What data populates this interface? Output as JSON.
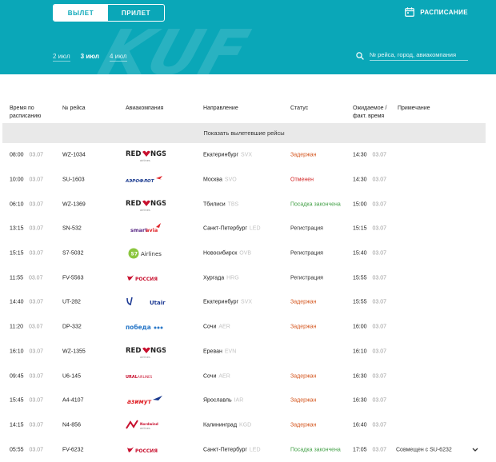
{
  "header": {
    "toggle": {
      "departure": "ВЫЛЕТ",
      "arrival": "ПРИЛЕТ"
    },
    "schedule_label": "РАСПИСАНИЕ",
    "watermark": "KUF",
    "dates": [
      "2 июл",
      "3 июл",
      "4 июл"
    ],
    "active_date": "3 июл",
    "search_placeholder": "№ рейса, город, авиакомпания",
    "accent_color": "#0aa7b8"
  },
  "table": {
    "columns": {
      "scheduled": "Время по расписанию",
      "flight": "№ рейса",
      "airline": "Авиакомпания",
      "destination": "Направление",
      "status": "Статус",
      "expected": "Ожидаемое / факт. время",
      "note": "Примечание"
    },
    "show_departed": "Показать вылетевшие рейсы",
    "rows": [
      {
        "time": "08:00",
        "date": "03.07",
        "flight": "WZ-1034",
        "airline": "redwings",
        "city": "Екатеринбург",
        "code": "SVX",
        "status": "Задержан",
        "status_type": "delayed",
        "exp_time": "14:30",
        "exp_date": "03.07",
        "note": ""
      },
      {
        "time": "10:00",
        "date": "03.07",
        "flight": "SU-1603",
        "airline": "aeroflot",
        "city": "Москва",
        "code": "SVO",
        "status": "Отменен",
        "status_type": "cancelled",
        "exp_time": "14:30",
        "exp_date": "03.07",
        "note": ""
      },
      {
        "time": "06:10",
        "date": "03.07",
        "flight": "WZ-1369",
        "airline": "redwings",
        "city": "Тбилиси",
        "code": "TBS",
        "status": "Посадка закончена",
        "status_type": "boarded",
        "exp_time": "15:00",
        "exp_date": "03.07",
        "note": ""
      },
      {
        "time": "13:15",
        "date": "03.07",
        "flight": "SN-532",
        "airline": "smartavia",
        "city": "Санкт-Петербург",
        "code": "LED",
        "status": "Регистрация",
        "status_type": "checkin",
        "exp_time": "15:15",
        "exp_date": "03.07",
        "note": ""
      },
      {
        "time": "15:15",
        "date": "03.07",
        "flight": "S7-5032",
        "airline": "s7",
        "city": "Новосибирск",
        "code": "OVB",
        "status": "Регистрация",
        "status_type": "checkin",
        "exp_time": "15:40",
        "exp_date": "03.07",
        "note": ""
      },
      {
        "time": "11:55",
        "date": "03.07",
        "flight": "FV-5563",
        "airline": "rossiya",
        "city": "Хургада",
        "code": "HRG",
        "status": "Регистрация",
        "status_type": "checkin",
        "exp_time": "15:55",
        "exp_date": "03.07",
        "note": ""
      },
      {
        "time": "14:40",
        "date": "03.07",
        "flight": "UT-282",
        "airline": "utair",
        "city": "Екатеринбург",
        "code": "SVX",
        "status": "Задержан",
        "status_type": "delayed",
        "exp_time": "15:55",
        "exp_date": "03.07",
        "note": ""
      },
      {
        "time": "11:20",
        "date": "03.07",
        "flight": "DP-332",
        "airline": "pobeda",
        "city": "Сочи",
        "code": "AER",
        "status": "Задержан",
        "status_type": "delayed",
        "exp_time": "16:00",
        "exp_date": "03.07",
        "note": ""
      },
      {
        "time": "16:10",
        "date": "03.07",
        "flight": "WZ-1355",
        "airline": "redwings",
        "city": "Ереван",
        "code": "EVN",
        "status": "",
        "status_type": "none",
        "exp_time": "16:10",
        "exp_date": "03.07",
        "note": ""
      },
      {
        "time": "09:45",
        "date": "03.07",
        "flight": "U6-145",
        "airline": "ural",
        "city": "Сочи",
        "code": "AER",
        "status": "Задержан",
        "status_type": "delayed",
        "exp_time": "16:30",
        "exp_date": "03.07",
        "note": ""
      },
      {
        "time": "15:45",
        "date": "03.07",
        "flight": "A4-4107",
        "airline": "azimuth",
        "city": "Ярославль",
        "code": "IAR",
        "status": "Задержан",
        "status_type": "delayed",
        "exp_time": "16:30",
        "exp_date": "03.07",
        "note": ""
      },
      {
        "time": "14:15",
        "date": "03.07",
        "flight": "N4-856",
        "airline": "nordwind",
        "city": "Калининград",
        "code": "KGD",
        "status": "Задержан",
        "status_type": "delayed",
        "exp_time": "16:40",
        "exp_date": "03.07",
        "note": ""
      },
      {
        "time": "05:55",
        "date": "03.07",
        "flight": "FV-6232",
        "airline": "rossiya",
        "city": "Санкт-Петербург",
        "code": "LED",
        "status": "Посадка закончена",
        "status_type": "boarded",
        "exp_time": "17:05",
        "exp_date": "03.07",
        "note": "Совмещен с SU-6232"
      }
    ]
  },
  "logos": {
    "redwings": {
      "text": "RED WINGS",
      "sub": "airlines",
      "color": "#c8102e"
    },
    "aeroflot": {
      "text": "АЭРОФЛОТ",
      "color": "#1a3a8f"
    },
    "smartavia": {
      "text": "smartavia",
      "color": "#5b2a86"
    },
    "s7": {
      "text": "Airlines",
      "badge": "S7",
      "color": "#8bc63e"
    },
    "rossiya": {
      "text": "РОССИЯ",
      "color": "#c8102e"
    },
    "utair": {
      "text": "Utair",
      "color": "#1f3c95"
    },
    "pobeda": {
      "text": "победа",
      "color": "#2a78c8"
    },
    "ural": {
      "text": "URAL AIRLINES",
      "color": "#c8102e"
    },
    "azimuth": {
      "text": "азимут",
      "color": "#e0262b"
    },
    "nordwind": {
      "text": "Nordwind",
      "sub": "airlines",
      "color": "#c8102e"
    }
  }
}
